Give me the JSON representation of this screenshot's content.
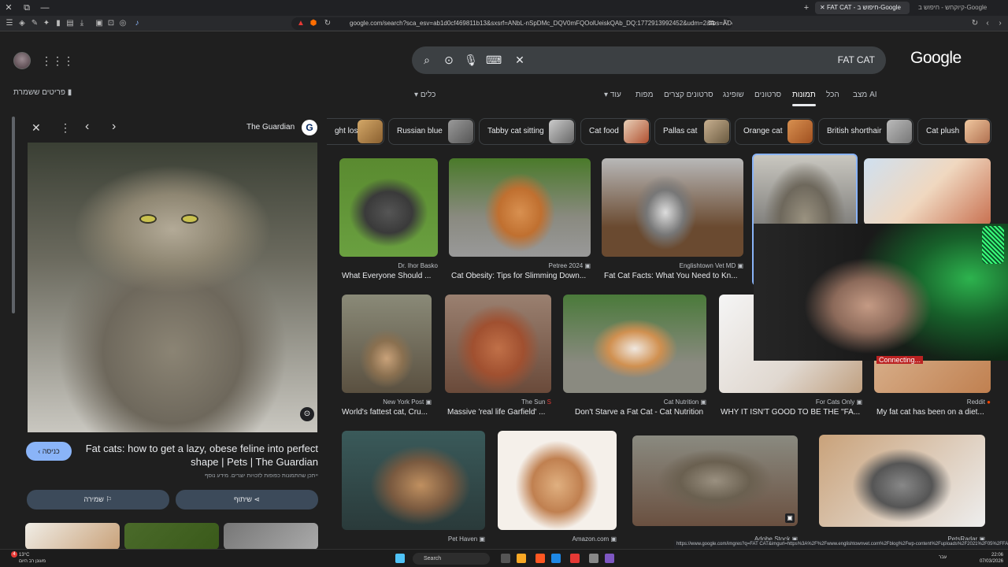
{
  "window": {
    "tab_active": "FAT CAT - חיפוש ב-Google",
    "tab_other": "קיוקחש - חיפוש ב-Google",
    "url": "google.com/search?sca_esv=ab1d0cf469811b13&sxsrf=ANbL-nSpDMc_DQV0mFQOolUeiskQAb_DQ:1772913992452&udm=2&fbs=ADc_l-bii..."
  },
  "search": {
    "query": "FAT CAT",
    "logo": "Google"
  },
  "nav": {
    "tabs": [
      "מצב AI",
      "הכל",
      "תמונות",
      "סרטונים",
      "שופינג",
      "סרטונים קצרים",
      "מפות",
      "עוד"
    ],
    "active_index": 2,
    "tools": "כלים",
    "saved": "פריטים ששמרת"
  },
  "chips": [
    {
      "label": "ght loss"
    },
    {
      "label": "Russian blue"
    },
    {
      "label": "Tabby cat sitting"
    },
    {
      "label": "Cat food"
    },
    {
      "label": "Pallas cat"
    },
    {
      "label": "Orange cat"
    },
    {
      "label": "British shorthair"
    },
    {
      "label": "Cat plush"
    }
  ],
  "preview": {
    "source": "The Guardian",
    "title": "Fat cats: how to get a lazy, obese feline into perfect shape | Pets | The Guardian",
    "visit": "כניסה",
    "note": "ייתכן שהתמונות כפופות לזכויות יוצרים. מידע נוסף",
    "save": "שמירה",
    "share": "שיתוף"
  },
  "results": [
    {
      "source": "Dr. Ihor Basko",
      "caption": "What Everyone Should ..."
    },
    {
      "source": "Petree 2024",
      "caption": "Cat Obesity: Tips for Slimming Down..."
    },
    {
      "source": "Englishtown Vet MD",
      "caption": "Fat Cat Facts: What You Need to Kn..."
    },
    {
      "source": "New York Post",
      "caption": "World's fattest cat, Cru..."
    },
    {
      "source": "The Sun",
      "caption": "Massive 'real life Garfield' ..."
    },
    {
      "source": "Cat Nutrition",
      "caption": "Don't Starve a Fat Cat - Cat Nutrition"
    },
    {
      "source": "For Cats Only",
      "caption": "WHY IT ISN'T GOOD TO BE THE \"FA..."
    },
    {
      "source": "Reddit",
      "caption": "My fat cat has been on a diet..."
    },
    {
      "source": "Pet Haven",
      "caption": ""
    },
    {
      "source": "Amazon.com",
      "caption": ""
    },
    {
      "source": "Adobe Stock",
      "caption": ""
    },
    {
      "source": "PetsRadar",
      "caption": ""
    }
  ],
  "overlay": {
    "connecting": "Connecting..."
  },
  "status_url": "https://www.google.com/imgres?q=FAT CAT&imgurl=https%3A%2F%2Fwww.englishtownvet.com%2Fblog%2Fwp-content%2Fuploads%2F2021%2F05%2FFA...",
  "taskbar": {
    "search": "Search",
    "weather_temp": "13°C",
    "weather_desc": "מעונן רב היום",
    "time": "22:06",
    "date": "07/03/2026",
    "lang": "עבר"
  }
}
